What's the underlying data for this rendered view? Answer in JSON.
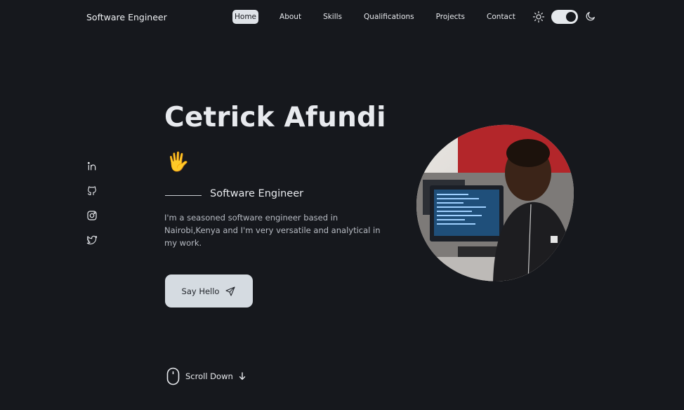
{
  "header": {
    "brand": "Software Engineer",
    "nav": [
      {
        "label": "Home",
        "active": true
      },
      {
        "label": "About"
      },
      {
        "label": "Skills"
      },
      {
        "label": "Qualifications"
      },
      {
        "label": "Projects"
      },
      {
        "label": "Contact"
      }
    ],
    "theme_toggle": {
      "left_icon": "sun-icon",
      "right_icon": "moon-icon",
      "state": "dark"
    }
  },
  "socials": [
    "linkedin-icon",
    "github-icon",
    "instagram-icon",
    "twitter-icon"
  ],
  "hero": {
    "name": "Cetrick Afundi",
    "wave_emoji": "🖐️",
    "subtitle": "Software Engineer",
    "description": "I'm a seasoned software engineer based in Nairobi,Kenya and I'm very versatile and analytical in my work.",
    "cta_label": "Say Hello",
    "cta_icon": "send-icon"
  },
  "scroll": {
    "label": "Scroll Down",
    "icon": "mouse-icon"
  },
  "colors": {
    "background": "#16181d",
    "accent": "#dfe3e8",
    "text": "#e8eaee"
  }
}
